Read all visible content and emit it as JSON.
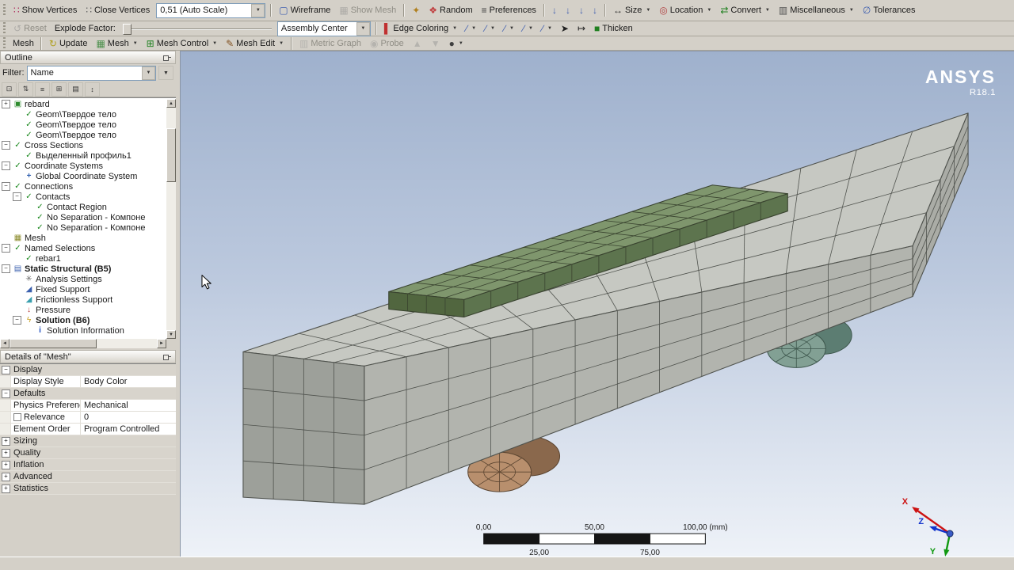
{
  "toolbar_top": {
    "items": [
      {
        "t": "grip"
      },
      {
        "t": "btn",
        "name": "show-vertices-button",
        "icon": "show-vertices-icon",
        "label": "Show Vertices"
      },
      {
        "t": "btn",
        "name": "close-vertices-button",
        "icon": "close-vertices-icon",
        "label": "Close Vertices"
      },
      {
        "t": "combo",
        "name": "vertex-scale-combo",
        "value": "0,51 (Auto Scale)",
        "w": 112
      },
      {
        "t": "sep"
      },
      {
        "t": "btn",
        "name": "wireframe-button",
        "icon": "wireframe-icon",
        "label": "Wireframe"
      },
      {
        "t": "btn",
        "name": "show-mesh-button",
        "icon": "show-mesh-icon",
        "label": "Show Mesh",
        "disabled": true
      },
      {
        "t": "sep"
      },
      {
        "t": "iconbtn",
        "name": "triad-button",
        "icon": "axes-icon"
      },
      {
        "t": "btn",
        "name": "random-button",
        "icon": "random-icon",
        "label": "Random"
      },
      {
        "t": "btn",
        "name": "preferences-button",
        "icon": "preferences-icon",
        "label": "Preferences"
      },
      {
        "t": "sep"
      },
      {
        "t": "iconbtn",
        "name": "annotation-button",
        "icon": "annotation-icon"
      },
      {
        "t": "iconbtn",
        "name": "annotation-button",
        "icon": "annotation-icon"
      },
      {
        "t": "iconbtn",
        "name": "annotation-button",
        "icon": "annotation-icon"
      },
      {
        "t": "iconbtn",
        "name": "annotation-button",
        "icon": "annotation-icon"
      },
      {
        "t": "sep"
      },
      {
        "t": "btn",
        "name": "size-button",
        "icon": "size-icon",
        "label": "Size",
        "dd": true
      },
      {
        "t": "btn",
        "name": "location-button",
        "icon": "location-icon",
        "label": "Location",
        "dd": true
      },
      {
        "t": "btn",
        "name": "convert-button",
        "icon": "convert-icon",
        "label": "Convert",
        "dd": true
      },
      {
        "t": "btn",
        "name": "miscellaneous-button",
        "icon": "misc-icon",
        "label": "Miscellaneous",
        "dd": true
      },
      {
        "t": "btn",
        "name": "tolerances-button",
        "icon": "tolerances-icon",
        "label": "Tolerances"
      }
    ]
  },
  "toolbar_display": {
    "items": [
      {
        "t": "grip"
      },
      {
        "t": "btn",
        "name": "reset-button",
        "icon": "reset-icon",
        "label": "Reset",
        "disabled": true
      },
      {
        "t": "label",
        "name": "explode-factor-label",
        "label": "Explode Factor:"
      },
      {
        "t": "slider",
        "name": "explode-factor-slider"
      },
      {
        "t": "combo",
        "name": "assembly-center-combo",
        "value": "Assembly Center",
        "w": 92
      },
      {
        "t": "sep"
      },
      {
        "t": "btn",
        "name": "edge-coloring-button",
        "icon": "edge-coloring-icon",
        "label": "Edge Coloring",
        "dd": true
      },
      {
        "t": "iconbtn",
        "name": "edge-direction-button",
        "icon": "edge-direction-icon",
        "dd": true
      },
      {
        "t": "iconbtn",
        "name": "edge-direction-button",
        "icon": "edge-direction-icon",
        "dd": true
      },
      {
        "t": "iconbtn",
        "name": "edge-direction-button",
        "icon": "edge-direction-icon",
        "dd": true
      },
      {
        "t": "iconbtn",
        "name": "edge-direction-button",
        "icon": "edge-direction-icon",
        "dd": true
      },
      {
        "t": "iconbtn",
        "name": "edge-direction-button",
        "icon": "edge-direction-icon",
        "dd": true
      },
      {
        "t": "iconbtn",
        "name": "edge-arrow-button",
        "icon": "edge-arrow-icon"
      },
      {
        "t": "iconbtn",
        "name": "edge-width-button",
        "icon": "edge-width-icon"
      },
      {
        "t": "btn",
        "name": "thicken-button",
        "icon": "thicken-icon",
        "label": "Thicken"
      }
    ]
  },
  "toolbar_mesh": {
    "items": [
      {
        "t": "grip"
      },
      {
        "t": "label",
        "name": "mesh-context-label",
        "label": "Mesh"
      },
      {
        "t": "sep"
      },
      {
        "t": "btn",
        "name": "update-button",
        "icon": "update-icon",
        "label": "Update"
      },
      {
        "t": "btn",
        "name": "mesh-dropdown-button",
        "icon": "mesh-icon",
        "label": "Mesh",
        "dd": true
      },
      {
        "t": "btn",
        "name": "mesh-control-button",
        "icon": "mesh-control-icon",
        "label": "Mesh Control",
        "dd": true
      },
      {
        "t": "btn",
        "name": "mesh-edit-button",
        "icon": "mesh-edit-icon",
        "label": "Mesh Edit",
        "dd": true
      },
      {
        "t": "sep"
      },
      {
        "t": "btn",
        "name": "metric-graph-button",
        "icon": "metric-graph-icon",
        "label": "Metric Graph",
        "disabled": true
      },
      {
        "t": "btn",
        "name": "probe-button",
        "icon": "probe-icon",
        "label": "Probe",
        "disabled": true
      },
      {
        "t": "iconbtn",
        "name": "max-button",
        "icon": "max-icon",
        "disabled": true
      },
      {
        "t": "iconbtn",
        "name": "min-button",
        "icon": "min-icon",
        "disabled": true
      },
      {
        "t": "iconbtn",
        "name": "display-options-button",
        "icon": "select-icon",
        "dd": true
      }
    ]
  },
  "outline": {
    "title": "Outline",
    "filter_label": "Filter:",
    "filter_value": "Name",
    "tree_toolbar": [
      "show-all-icon",
      "expand-tree-icon",
      "flat-view-icon",
      "plus-box-icon",
      "folder-icon",
      "sort-az-icon"
    ],
    "tree": [
      {
        "indent": 1,
        "expander": "plus",
        "icon": "cube",
        "label": "rebard"
      },
      {
        "indent": 2,
        "icon": "check",
        "label": "Geom\\Твердое тело"
      },
      {
        "indent": 2,
        "icon": "check",
        "label": "Geom\\Твердое тело"
      },
      {
        "indent": 2,
        "icon": "check",
        "label": "Geom\\Твердое тело"
      },
      {
        "indent": 1,
        "expander": "minus",
        "icon": "check",
        "label": "Cross Sections"
      },
      {
        "indent": 2,
        "icon": "check",
        "label": "Выделенный профиль1"
      },
      {
        "indent": 1,
        "expander": "minus",
        "icon": "check",
        "label": "Coordinate Systems"
      },
      {
        "indent": 2,
        "icon": "axes",
        "label": "Global Coordinate System"
      },
      {
        "indent": 1,
        "expander": "minus",
        "icon": "check",
        "label": "Connections"
      },
      {
        "indent": 2,
        "expander": "minus",
        "icon": "check",
        "label": "Contacts"
      },
      {
        "indent": 3,
        "icon": "check",
        "label": "Contact Region"
      },
      {
        "indent": 3,
        "icon": "check",
        "label": "No Separation - Компоне"
      },
      {
        "indent": 3,
        "icon": "check",
        "label": "No Separation - Компоне"
      },
      {
        "indent": 1,
        "icon": "mesh",
        "label": "Mesh"
      },
      {
        "indent": 1,
        "expander": "minus",
        "icon": "check",
        "label": "Named Selections"
      },
      {
        "indent": 2,
        "icon": "check",
        "label": "rebar1"
      },
      {
        "indent": 1,
        "expander": "minus",
        "icon": "chart",
        "label": "Static Structural (B5)",
        "bold": true
      },
      {
        "indent": 2,
        "icon": "gear",
        "label": "Analysis Settings"
      },
      {
        "indent": 2,
        "icon": "support",
        "label": "Fixed Support"
      },
      {
        "indent": 2,
        "icon": "support2",
        "label": "Frictionless Support"
      },
      {
        "indent": 2,
        "icon": "pressure",
        "label": "Pressure"
      },
      {
        "indent": 2,
        "expander": "minus",
        "icon": "bolt",
        "label": "Solution (B6)",
        "bold": true
      },
      {
        "indent": 3,
        "icon": "info",
        "label": "Solution Information"
      }
    ]
  },
  "details": {
    "title": "Details of \"Mesh\"",
    "rows": [
      {
        "type": "section",
        "label": "Display",
        "expanded": true
      },
      {
        "type": "prop",
        "label": "Display Style",
        "value": "Body Color"
      },
      {
        "type": "section",
        "label": "Defaults",
        "expanded": true
      },
      {
        "type": "prop",
        "label": "Physics Preference",
        "value": "Mechanical"
      },
      {
        "type": "prop",
        "label": "Relevance",
        "value": "0",
        "checkbox": true
      },
      {
        "type": "prop",
        "label": "Element Order",
        "value": "Program Controlled"
      },
      {
        "type": "section",
        "label": "Sizing",
        "expanded": false
      },
      {
        "type": "section",
        "label": "Quality",
        "expanded": false
      },
      {
        "type": "section",
        "label": "Inflation",
        "expanded": false
      },
      {
        "type": "section",
        "label": "Advanced",
        "expanded": false
      },
      {
        "type": "section",
        "label": "Statistics",
        "expanded": false
      }
    ]
  },
  "viewport": {
    "brand": "ANSYS",
    "brand_version": "R18.1",
    "ruler": {
      "top_labels": [
        "0,00",
        "50,00",
        "100,00 (mm)"
      ],
      "bottom_labels": [
        "25,00",
        "75,00"
      ]
    },
    "triad": {
      "x_label": "X",
      "y_label": "Y",
      "z_label": "Z"
    }
  }
}
